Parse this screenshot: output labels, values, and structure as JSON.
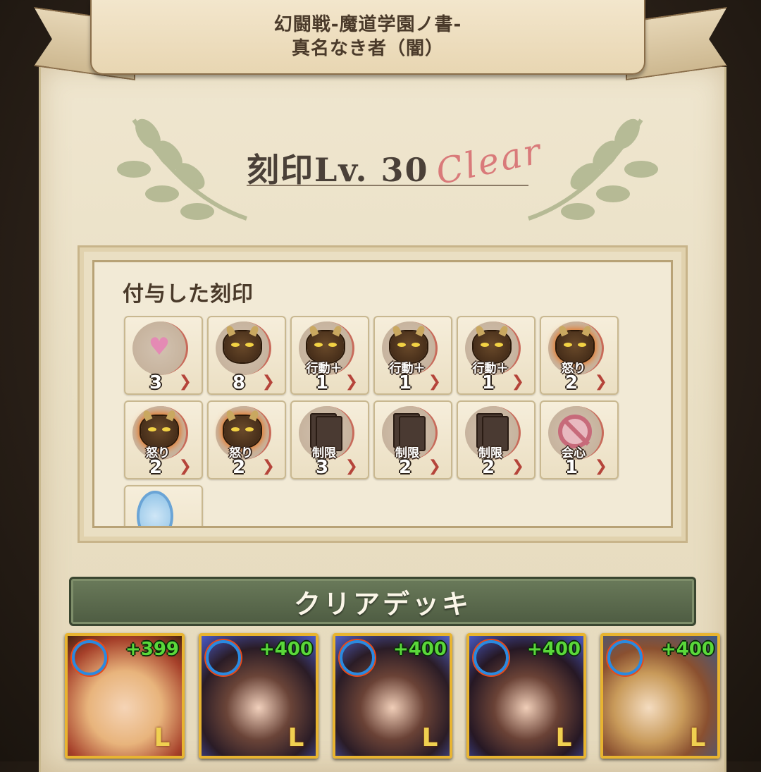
{
  "banner": {
    "line1": "幻闘戦-魔道学園ノ書-",
    "line2": "真名なき者（闇）"
  },
  "level": {
    "text": "刻印Lv. 30",
    "clear": "Clear"
  },
  "seals": {
    "title": "付与した刻印",
    "items": [
      {
        "icon": "sword-heart-debuff-icon",
        "label": "",
        "count": "3"
      },
      {
        "icon": "demon-heart-buff-icon",
        "label": "",
        "count": "8"
      },
      {
        "icon": "demon-action-icon",
        "label": "行動＋",
        "count": "1"
      },
      {
        "icon": "demon-action-icon",
        "label": "行動＋",
        "count": "1"
      },
      {
        "icon": "demon-action-icon",
        "label": "行動＋",
        "count": "1"
      },
      {
        "icon": "demon-rage-icon",
        "label": "怒り",
        "count": "2"
      },
      {
        "icon": "demon-rage-icon",
        "label": "怒り",
        "count": "2"
      },
      {
        "icon": "demon-rage-icon",
        "label": "怒り",
        "count": "2"
      },
      {
        "icon": "card-limit-icon",
        "label": "制限",
        "count": "3"
      },
      {
        "icon": "card-limit-icon",
        "label": "制限",
        "count": "2"
      },
      {
        "icon": "card-limit-icon",
        "label": "制限",
        "count": "2"
      },
      {
        "icon": "no-critical-icon",
        "label": "会心",
        "count": "1"
      },
      {
        "icon": "blue-sigil-icon",
        "label": "",
        "count": ""
      }
    ]
  },
  "deck": {
    "title": "クリアデッキ",
    "cards": [
      {
        "plus": "+399"
      },
      {
        "plus": "+400"
      },
      {
        "plus": "+400"
      },
      {
        "plus": "+400"
      },
      {
        "plus": "+400"
      }
    ]
  }
}
